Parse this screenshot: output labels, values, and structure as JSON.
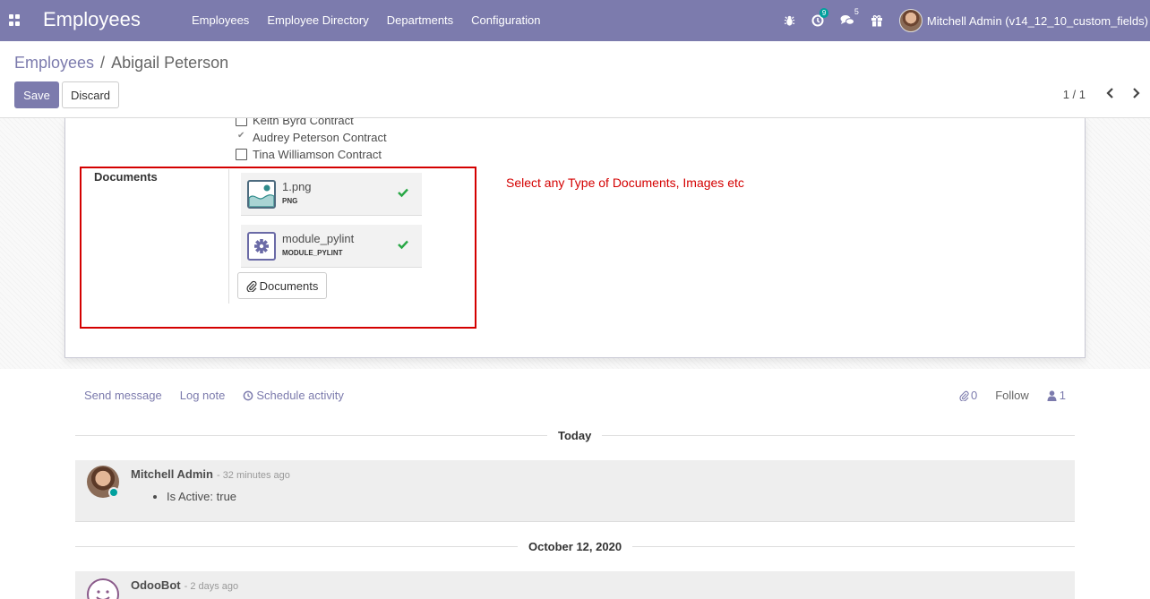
{
  "navbar": {
    "app_title": "Employees",
    "menu": [
      "Employees",
      "Employee Directory",
      "Departments",
      "Configuration"
    ],
    "activity_count": "9",
    "messages_count": "5",
    "user_name": "Mitchell Admin (v14_12_10_custom_fields)"
  },
  "breadcrumb": {
    "parent": "Employees",
    "separator": "/",
    "current": "Abigail Peterson"
  },
  "buttons": {
    "save": "Save",
    "discard": "Discard"
  },
  "pager": {
    "value": "1 / 1"
  },
  "form": {
    "contracts": [
      {
        "label": "Keith Byrd Contract",
        "checked": false
      },
      {
        "label": "Audrey Peterson Contract",
        "checked": true
      },
      {
        "label": "Tina Williamson Contract",
        "checked": false
      }
    ],
    "documents_label": "Documents",
    "attachments": [
      {
        "name": "1.png",
        "ext": "PNG",
        "icon": "image-file-icon"
      },
      {
        "name": "module_pylint",
        "ext": "MODULE_PYLINT",
        "icon": "gear-file-icon"
      }
    ],
    "documents_button": "Documents",
    "annotation": "Select any Type of Documents, Images etc"
  },
  "chatter": {
    "send_message": "Send message",
    "log_note": "Log note",
    "schedule_activity": "Schedule activity",
    "attachments_count": "0",
    "follow": "Follow",
    "followers_count": "1",
    "date_today": "Today",
    "date_older": "October 12, 2020",
    "messages": [
      {
        "author": "Mitchell Admin",
        "time": "- 32 minutes ago",
        "body": "Is Active: true"
      },
      {
        "author": "OdooBot",
        "time": "- 2 days ago",
        "body": ""
      }
    ]
  },
  "colors": {
    "brand": "#7c7bad",
    "annotation_red": "#d40000",
    "success_green": "#28a745"
  }
}
